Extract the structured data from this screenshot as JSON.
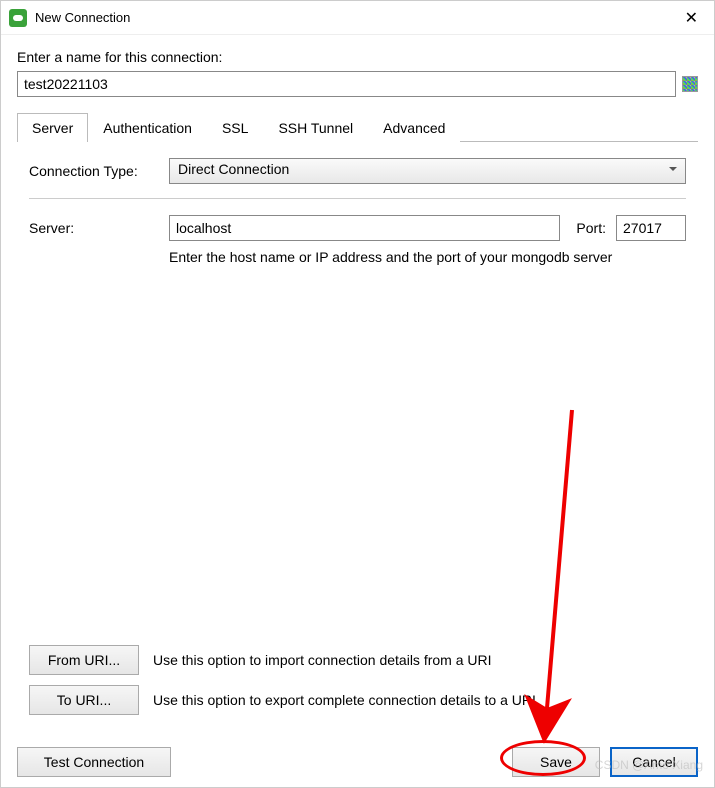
{
  "titlebar": {
    "title": "New Connection"
  },
  "labels": {
    "name_prompt": "Enter a name for this connection:",
    "connection_type": "Connection Type:",
    "server": "Server:",
    "port": "Port:",
    "server_hint": "Enter the host name or IP address and the port of your mongodb server"
  },
  "inputs": {
    "connection_name": "test20221103",
    "connection_type_value": "Direct Connection",
    "server_value": "localhost",
    "port_value": "27017"
  },
  "tabs": [
    {
      "id": "server",
      "label": "Server",
      "active": true
    },
    {
      "id": "authentication",
      "label": "Authentication",
      "active": false
    },
    {
      "id": "ssl",
      "label": "SSL",
      "active": false
    },
    {
      "id": "ssh",
      "label": "SSH Tunnel",
      "active": false
    },
    {
      "id": "advanced",
      "label": "Advanced",
      "active": false
    }
  ],
  "uri": {
    "from_label": "From URI...",
    "from_desc": "Use this option to import connection details from a URI",
    "to_label": "To URI...",
    "to_desc": "Use this option to export complete connection details to a URI"
  },
  "footer": {
    "test": "Test Connection",
    "save": "Save",
    "cancel": "Cancel"
  },
  "watermark": "CSDN @Amo Xiang"
}
